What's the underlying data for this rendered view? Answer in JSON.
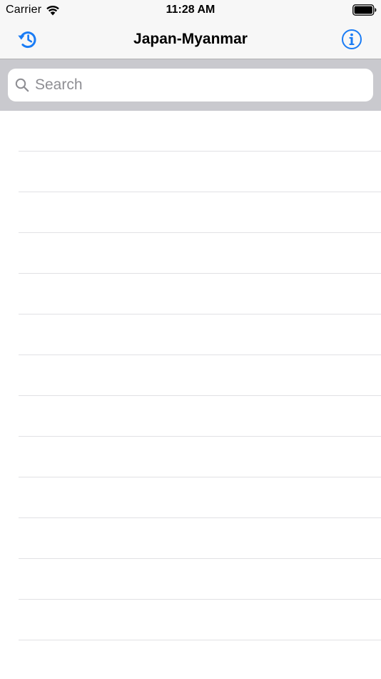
{
  "status_bar": {
    "carrier": "Carrier",
    "time": "11:28 AM",
    "wifi_icon": "wifi-icon",
    "battery_icon": "battery-icon",
    "battery_level": 1.0
  },
  "nav_bar": {
    "title": "Japan-Myanmar",
    "left_icon": "history-icon",
    "right_icon": "info-icon",
    "accent_color": "#1a7cf5"
  },
  "search": {
    "placeholder": "Search",
    "value": "",
    "icon": "search-icon"
  },
  "table": {
    "visible_rows": 14,
    "rows": []
  },
  "colors": {
    "nav_background": "#f7f7f7",
    "search_bar_background": "#c9c9ce",
    "separator": "#e1e1e4",
    "accent": "#1a7cf5"
  }
}
